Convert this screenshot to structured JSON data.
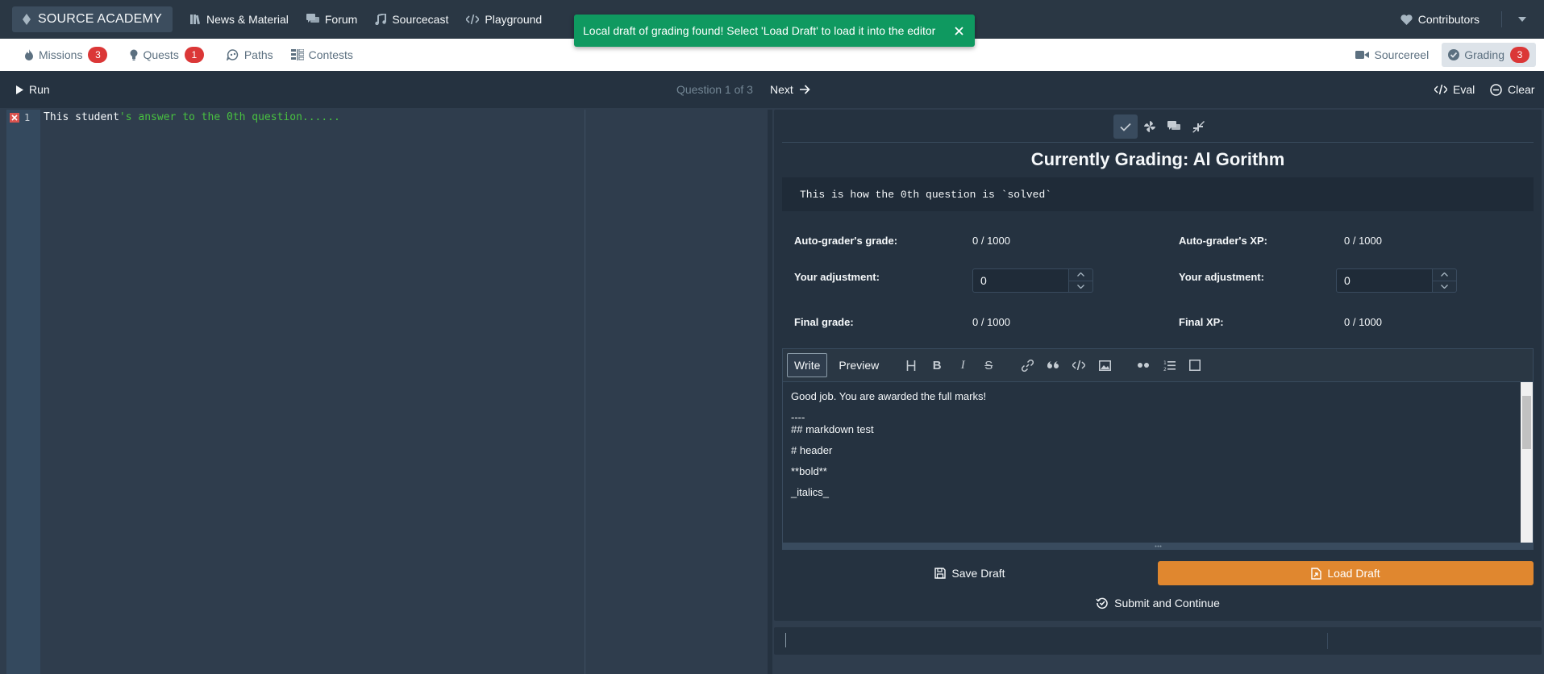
{
  "topbar": {
    "brand": "SOURCE ACADEMY",
    "nav": [
      {
        "label": "News & Material",
        "icon": "library-icon"
      },
      {
        "label": "Forum",
        "icon": "chat-icon"
      },
      {
        "label": "Sourcecast",
        "icon": "music-icon"
      },
      {
        "label": "Playground",
        "icon": "code-icon"
      }
    ],
    "contributors": "Contributors"
  },
  "toast": {
    "message": "Local draft of grading found! Select 'Load Draft' to load it into the editor",
    "color": "#0f9960"
  },
  "subbar": {
    "items": [
      {
        "label": "Missions",
        "badge": "3"
      },
      {
        "label": "Quests",
        "badge": "1"
      },
      {
        "label": "Paths"
      },
      {
        "label": "Contests"
      }
    ],
    "sourcereel": "Sourcereel",
    "grading": {
      "label": "Grading",
      "badge": "3"
    }
  },
  "controls": {
    "run": "Run",
    "question_counter": "Question 1 of 3",
    "next": "Next",
    "eval": "Eval",
    "clear": "Clear"
  },
  "editor": {
    "line_number": "1",
    "code_plain": "This student",
    "code_string": "'s answer to the 0th question......"
  },
  "grading": {
    "title": "Currently Grading: Al Gorithm",
    "solution": "This is how the 0th question is `solved`",
    "autograder_grade_label": "Auto-grader's grade:",
    "autograder_grade_value": "0 / 1000",
    "autograder_xp_label": "Auto-grader's XP:",
    "autograder_xp_value": "0 / 1000",
    "adjustment_label": "Your adjustment:",
    "grade_adjustment_value": "0",
    "xp_adjustment_value": "0",
    "final_grade_label": "Final grade:",
    "final_grade_value": "0 / 1000",
    "final_xp_label": "Final XP:",
    "final_xp_value": "0 / 1000",
    "md_write": "Write",
    "md_preview": "Preview",
    "comment_lines": [
      "Good job. You are awarded the full marks!",
      "",
      "----",
      "## markdown test",
      "",
      "# header",
      "",
      "**bold**",
      "",
      "_italics_"
    ],
    "save_draft": "Save Draft",
    "load_draft": "Load Draft",
    "submit": "Submit and Continue",
    "accent_color": "#e0872f"
  }
}
